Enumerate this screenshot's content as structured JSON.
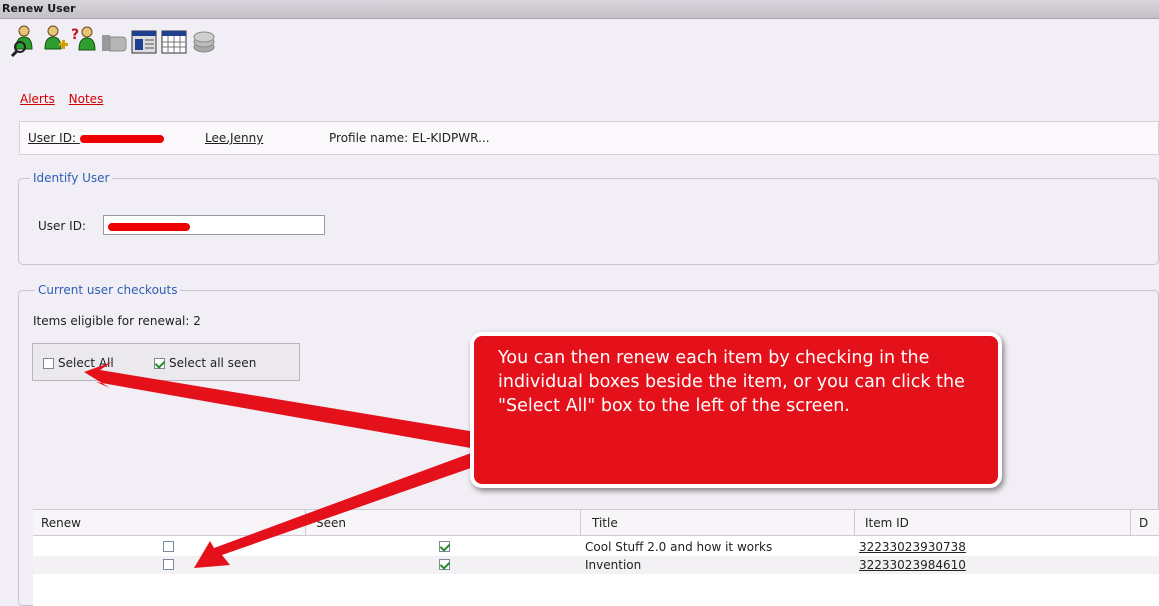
{
  "window": {
    "title": "Renew User"
  },
  "toolbar": {
    "buttons": [
      {
        "icon": "user-search-icon"
      },
      {
        "icon": "user-add-icon"
      },
      {
        "icon": "user-help-icon"
      },
      {
        "icon": "hand-pointer-icon"
      },
      {
        "icon": "calendar-window-icon"
      },
      {
        "icon": "calendar-grid-icon"
      },
      {
        "icon": "disk-stack-icon"
      }
    ]
  },
  "links": {
    "alerts": "Alerts",
    "notes": "Notes"
  },
  "user_bar": {
    "user_id_label": "User ID: ",
    "user_name": "Lee,Jenny",
    "profile": "Profile name: EL-KIDPWR..."
  },
  "identify": {
    "legend": "Identify User",
    "user_id_label": "User ID:"
  },
  "checkouts": {
    "legend": "Current user checkouts",
    "eligible": "Items eligible for renewal: 2",
    "select_all_label": "Select All",
    "select_all_checked": false,
    "select_all_seen_label": "Select all seen",
    "select_all_seen_checked": true
  },
  "table": {
    "headers": [
      "Renew",
      "Seen",
      "Title",
      "Item ID",
      "D"
    ],
    "rows": [
      {
        "renew": false,
        "seen": true,
        "title": "Cool Stuff 2.0 and how it works",
        "item_id": "32233023930738"
      },
      {
        "renew": false,
        "seen": true,
        "title": "Invention",
        "item_id": "32233023984610"
      }
    ]
  },
  "callout": {
    "text": "You can then renew each item by checking in the individual boxes beside the item, or you can click the \"Select All\" box to the left of the screen."
  },
  "colors": {
    "accent": "#2f5fb3",
    "link": "#d20000",
    "callout": "#e4111a",
    "background": "#f1eef5"
  }
}
